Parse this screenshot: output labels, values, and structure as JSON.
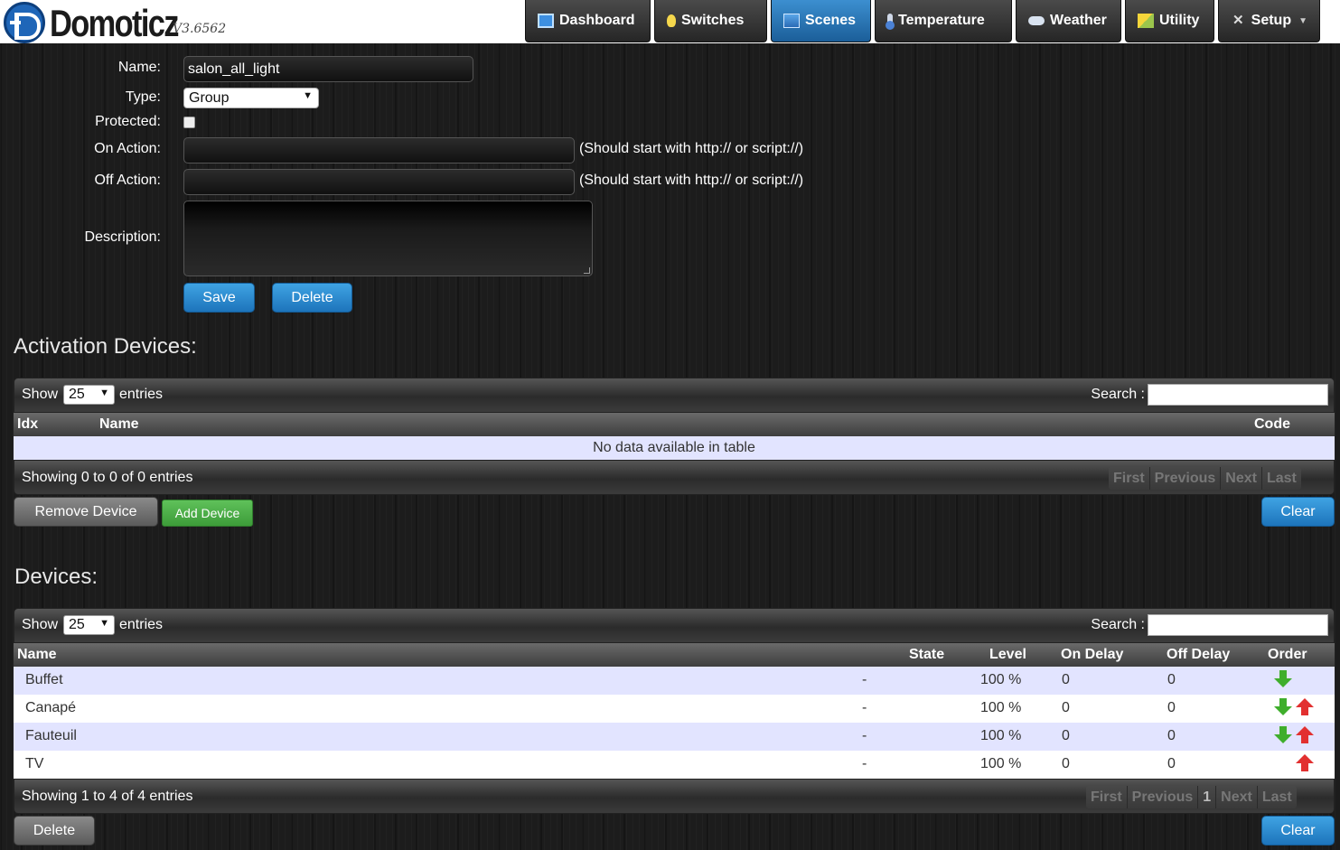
{
  "app": {
    "name": "Domoticz",
    "version": "V3.6562"
  },
  "nav": {
    "dashboard": "Dashboard",
    "switches": "Switches",
    "scenes": "Scenes",
    "temperature": "Temperature",
    "weather": "Weather",
    "utility": "Utility",
    "setup": "Setup"
  },
  "colors": {
    "active_tab": "#2a78bf",
    "header_bg": "#ffffff",
    "odd_row": "#e2e4ff"
  },
  "form": {
    "name_label": "Name:",
    "name_value": "salon_all_light",
    "type_label": "Type:",
    "type_value": "Group",
    "protected_label": "Protected:",
    "on_action_label": "On Action:",
    "on_action_value": "",
    "off_action_label": "Off Action:",
    "off_action_value": "",
    "action_hint": "(Should start with http:// or script://)",
    "description_label": "Description:",
    "save_label": "Save",
    "delete_label": "Delete"
  },
  "activation": {
    "title": "Activation Devices:",
    "show_label": "Show",
    "page_size": "25",
    "entries_label": "entries",
    "search_label": "Search :",
    "columns": {
      "idx": "Idx",
      "name": "Name",
      "code": "Code"
    },
    "empty_text": "No data available in table",
    "info": "Showing 0 to 0 of 0 entries",
    "pager": {
      "first": "First",
      "previous": "Previous",
      "next": "Next",
      "last": "Last"
    },
    "remove_label": "Remove Device",
    "add_label": "Add Device",
    "clear_label": "Clear"
  },
  "devices": {
    "title": "Devices:",
    "show_label": "Show",
    "page_size": "25",
    "entries_label": "entries",
    "search_label": "Search :",
    "columns": {
      "name": "Name",
      "state": "State",
      "level": "Level",
      "on_delay": "On Delay",
      "off_delay": "Off Delay",
      "order": "Order"
    },
    "rows": [
      {
        "name": "Buffet",
        "state": "-",
        "level": "100 %",
        "on_delay": "0",
        "off_delay": "0"
      },
      {
        "name": "Canapé",
        "state": "-",
        "level": "100 %",
        "on_delay": "0",
        "off_delay": "0"
      },
      {
        "name": "Fauteuil",
        "state": "-",
        "level": "100 %",
        "on_delay": "0",
        "off_delay": "0"
      },
      {
        "name": "TV",
        "state": "-",
        "level": "100 %",
        "on_delay": "0",
        "off_delay": "0"
      }
    ],
    "info": "Showing 1 to 4 of 4 entries",
    "pager": {
      "first": "First",
      "previous": "Previous",
      "page": "1",
      "next": "Next",
      "last": "Last"
    },
    "delete_label": "Delete",
    "clear_label": "Clear"
  }
}
